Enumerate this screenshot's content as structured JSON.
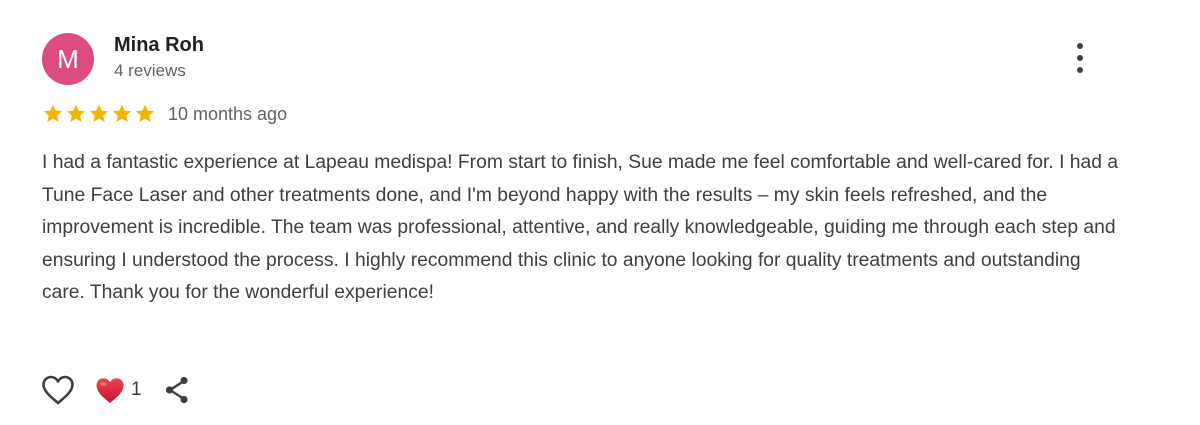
{
  "review": {
    "author": {
      "initial": "M",
      "name": "Mina Roh",
      "review_count": "4 reviews",
      "avatar_color": "#dd4c82"
    },
    "rating": 5,
    "rating_max": 5,
    "star_color": "#f4b400",
    "time": "10 months ago",
    "text": "I had a fantastic experience at Lapeau medispa! From start to finish, Sue made me feel comfortable and well-cared for. I had a Tune Face Laser and other treatments done, and I'm beyond happy with the results – my skin feels refreshed, and the improvement is incredible. The team was professional, attentive, and really knowledgeable, guiding me through each step and ensuring I understood the process. I highly recommend this clinic to anyone looking for quality treatments and outstanding care. Thank you for the wonderful experience!",
    "actions": {
      "like_icon": "heart-outline-icon",
      "reaction_icon": "red-heart-emoji-icon",
      "reaction_count": "1",
      "share_icon": "share-icon"
    },
    "more_icon": "more-vert-icon"
  }
}
